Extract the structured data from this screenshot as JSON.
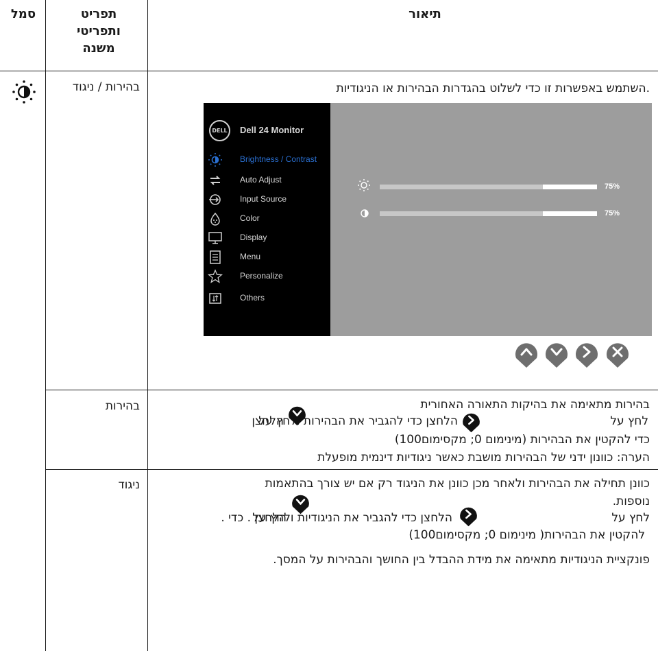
{
  "table": {
    "header": {
      "icon_col": "סמל",
      "item_col": "תפריט ותפריטי משנה",
      "desc_col": "תיאור"
    },
    "rows": [
      {
        "item": "בהירות / ניגוד",
        "icon": "brightness-contrast-icon",
        "description": ".השתמש באפשרות זו כדי לשלוט בהגדרות הבהירות או הניגודיות"
      },
      {
        "item": "בהירות",
        "lines": [
          "בהירות מתאימה את בהיקות התאורה האחורית",
          "לחץ על",
          "הלחצן כדי להגביר את הבהירות ולחץ על",
          "הלחצן",
          "כדי להקטין את הבהירות (מינימום 0; מקסימום100)",
          "הערה: כוונון ידני של הבהירות מושבת כאשר ניגודיות דינמית מופעלת"
        ]
      },
      {
        "item": "ניגוד",
        "lines": [
          "כוונן תחילה את הבהירות ולאחר מכן כוונן את הניגוד רק אם יש צורך בהתאמות",
          "נוספות.",
          "לחץ על",
          "הלחצן כדי להגביר את הניגודיות ולחץ על",
          "הלחצן . כדי  .",
          "להקטין את הבהירות( מינימום 0; מקסימום100)",
          "פונקציית הניגודיות מתאימה את מידת ההבדל בין החושך והבהירות על המסך."
        ]
      }
    ]
  },
  "osd": {
    "logo": "DELL",
    "title": "Dell 24 Monitor",
    "menu": [
      {
        "label": "Brightness / Contrast",
        "icon": "brightness-contrast-icon",
        "active": true
      },
      {
        "label": "Auto Adjust",
        "icon": "auto-adjust-icon",
        "active": false
      },
      {
        "label": "Input Source",
        "icon": "input-source-icon",
        "active": false
      },
      {
        "label": "Color",
        "icon": "color-icon",
        "active": false
      },
      {
        "label": "Display",
        "icon": "display-icon",
        "active": false
      },
      {
        "label": "Menu",
        "icon": "menu-icon",
        "active": false
      },
      {
        "label": "Personalize",
        "icon": "star-icon",
        "active": false
      },
      {
        "label": "Others",
        "icon": "others-icon",
        "active": false
      }
    ],
    "brightness": {
      "label": "75%",
      "value": 0.75
    },
    "contrast": {
      "label": "75%",
      "value": 0.75
    },
    "buttons": [
      "up-button",
      "down-button",
      "right-button",
      "close-button"
    ]
  },
  "colors": {
    "osd_panel": "#9d9d9d",
    "osd_sidebar": "#000000",
    "osd_active": "#2a6fd0",
    "nav_button": "#6e6e6e"
  }
}
